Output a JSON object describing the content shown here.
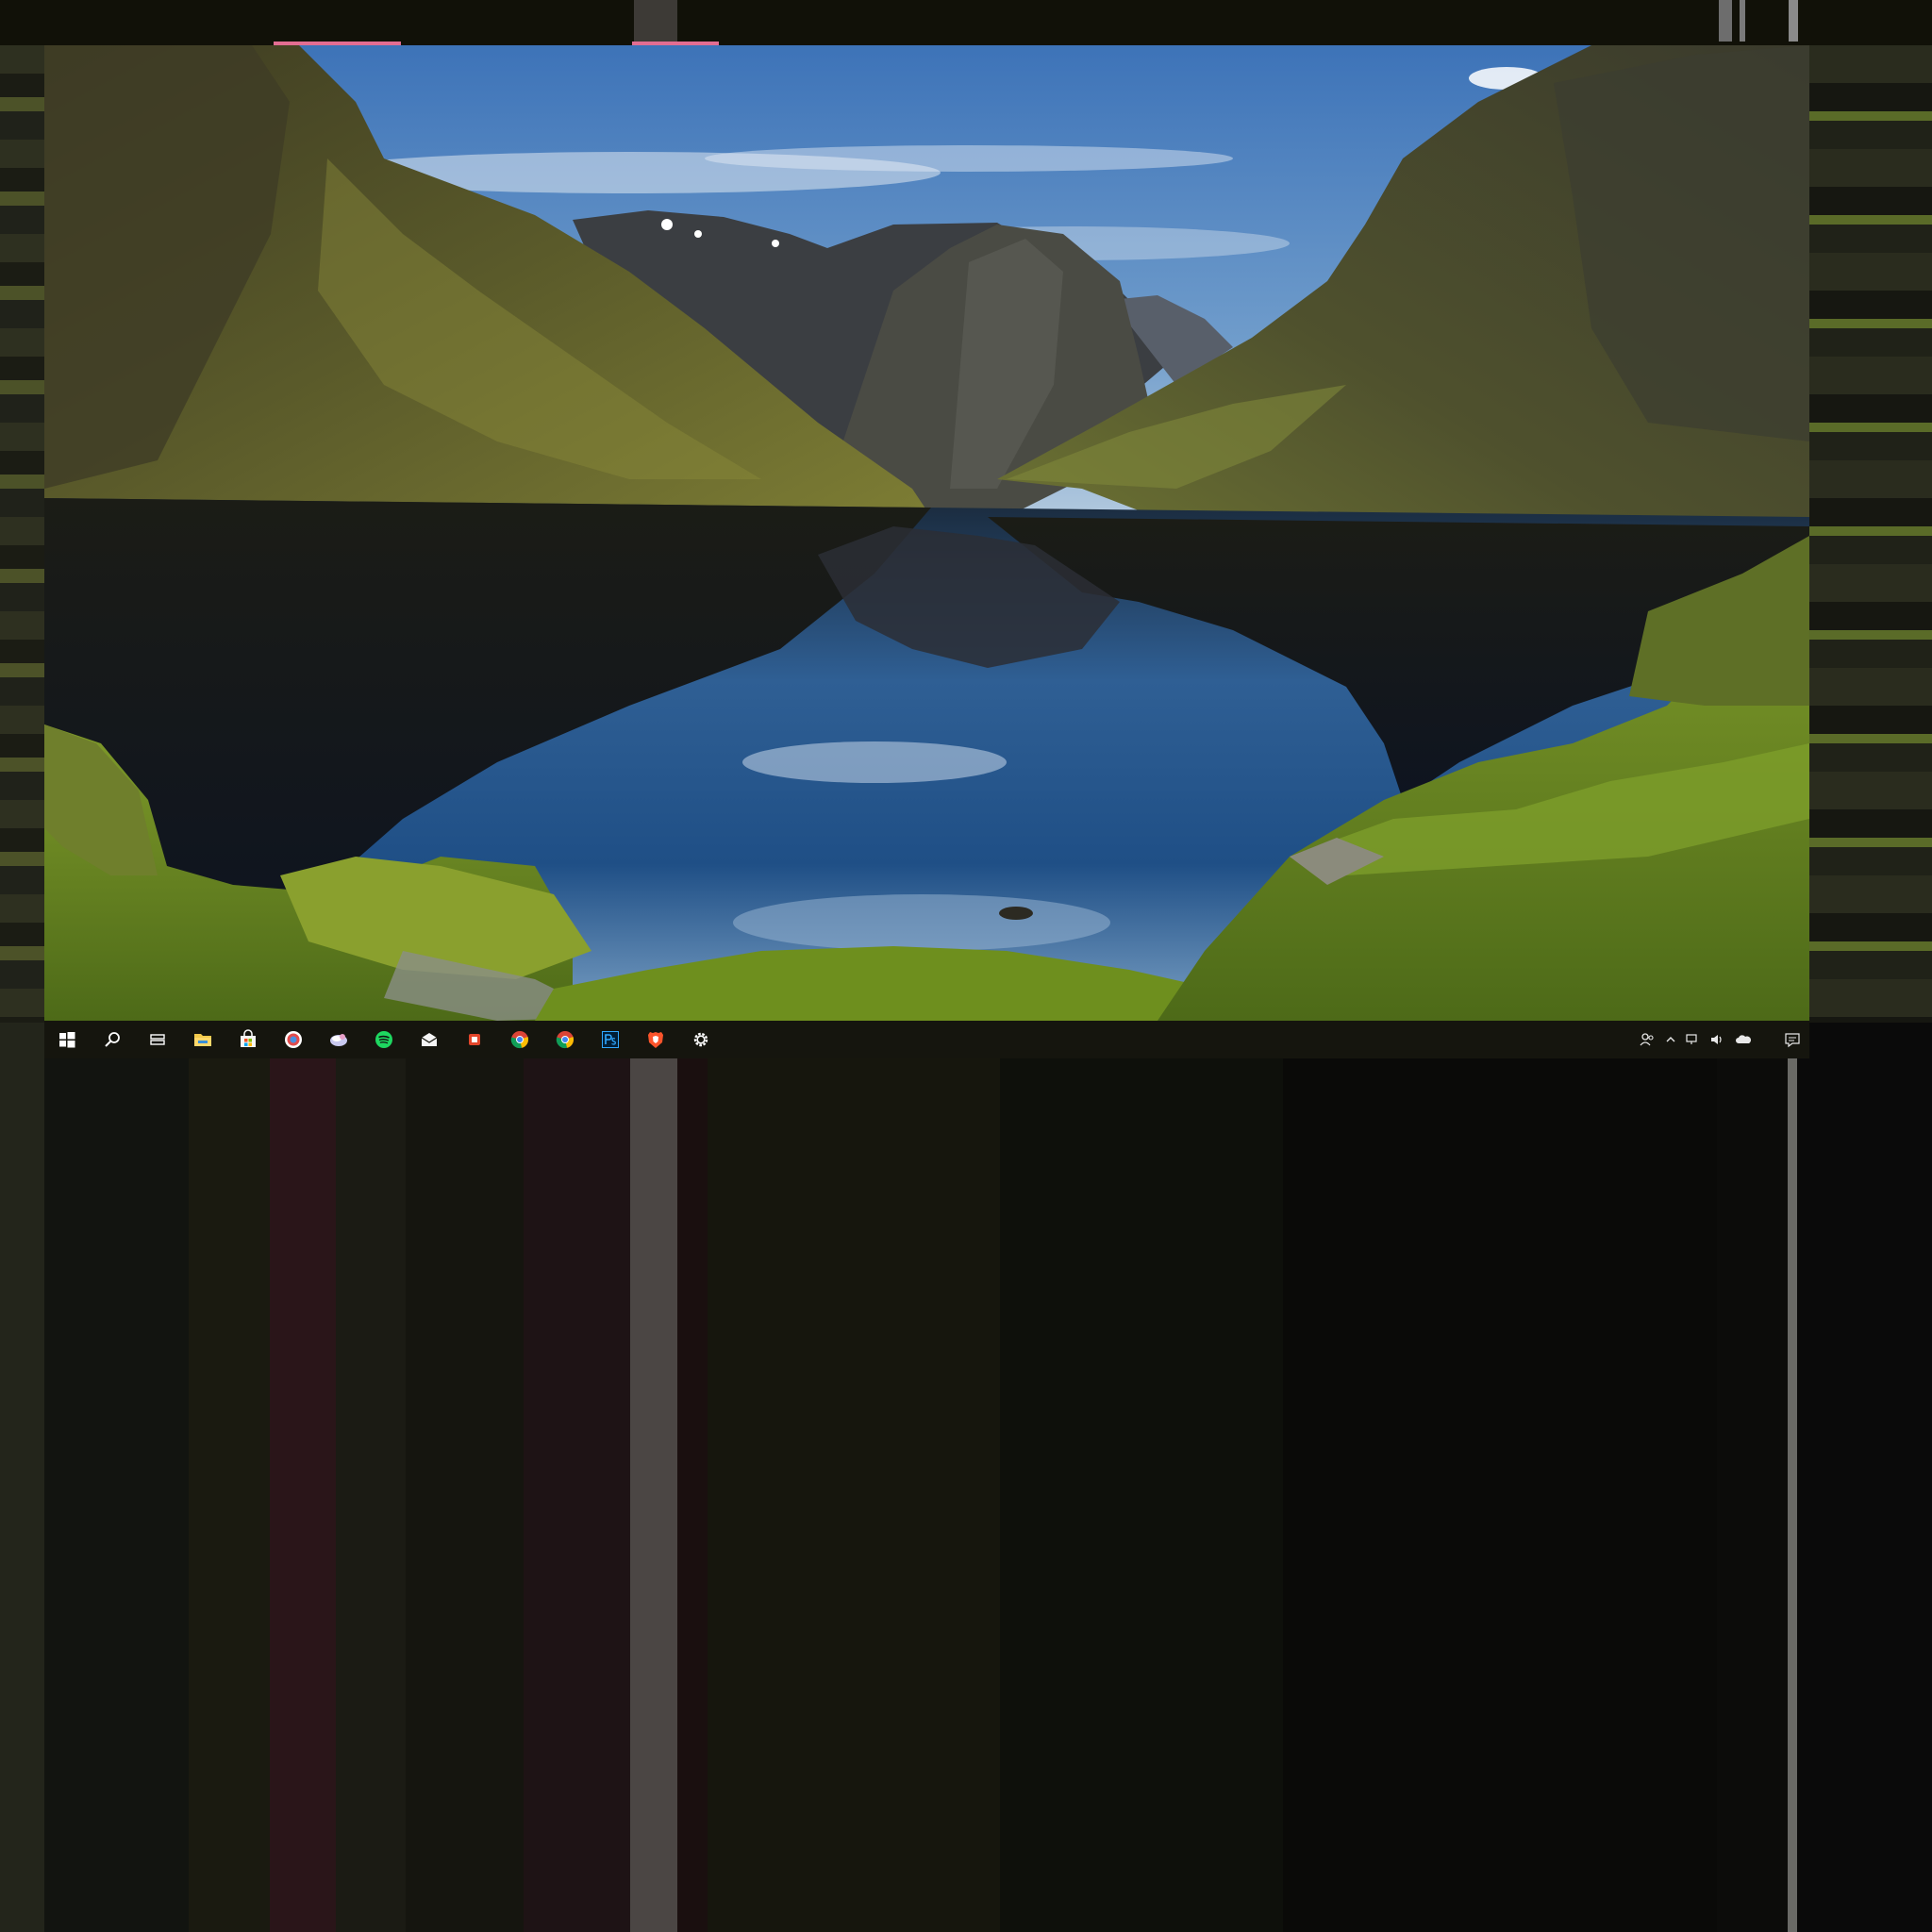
{
  "screen": {
    "accent_color": "#15150e",
    "taskbar_text_color": "#e8e8e8"
  },
  "taskbar": {
    "pinned": [
      {
        "icon": "windows-start-icon",
        "color": "#ffffff"
      },
      {
        "icon": "search-icon",
        "color": "#ffffff"
      },
      {
        "icon": "task-view-icon",
        "color": "#ffffff"
      },
      {
        "icon": "file-explorer-icon",
        "color": "#f2c94c"
      },
      {
        "icon": "store-icon",
        "color": "#f5f5f5"
      },
      {
        "icon": "browser-icon",
        "color": "#e34c4c"
      },
      {
        "icon": "app-icon",
        "color": "#d9d9ff"
      },
      {
        "icon": "spotify-icon",
        "color": "#1ed760"
      },
      {
        "icon": "mail-icon",
        "color": "#f5f5f5"
      },
      {
        "icon": "office-icon",
        "color": "#e2452a"
      },
      {
        "icon": "chrome-icon",
        "color": "#fbbc04"
      },
      {
        "icon": "chrome-icon",
        "color": "#fbbc04"
      },
      {
        "icon": "photoshop-icon",
        "color": "#31a8ff"
      },
      {
        "icon": "brave-icon",
        "color": "#fb542b"
      },
      {
        "icon": "settings-gear-icon",
        "color": "#ffffff"
      }
    ]
  },
  "tray": {
    "people_icon": "people-icon",
    "chevron_icon": "chevron-up-icon",
    "network_icon": "network-icon",
    "volume_icon": "volume-icon",
    "onedrive_icon": "onedrive-icon",
    "notification_icon": "action-center-icon"
  }
}
